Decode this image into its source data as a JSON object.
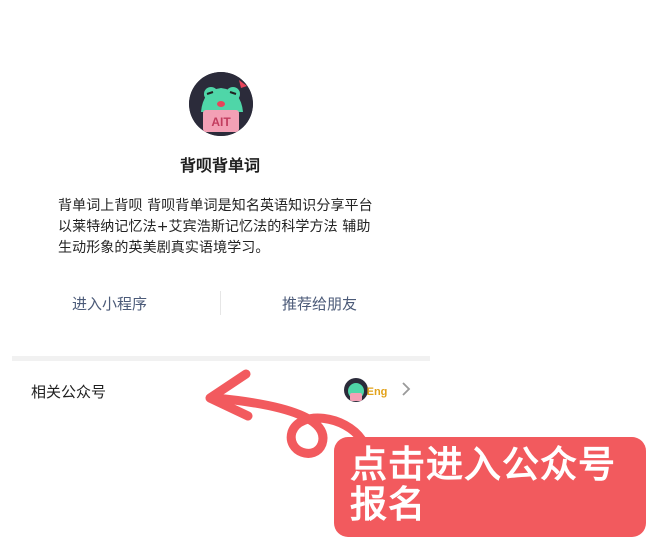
{
  "app": {
    "name": "背呗背单词",
    "description": "背单词上背呗 背呗背单词是知名英语知识分享平台 以莱特纳记忆法+艾宾浩斯记忆法的科学方法 辅助生动形象的英美剧真实语境学习。",
    "avatar_icon": "frog-mascot-icon"
  },
  "actions": {
    "enter_miniprogram": "进入小程序",
    "recommend_friends": "推荐给朋友"
  },
  "related": {
    "label": "相关公众号",
    "thumb_icon": "frog-eng-logo-icon",
    "chevron_icon": "chevron-right-icon"
  },
  "callout": {
    "text": "点击进入公众号报名",
    "color": "#f25a5e"
  }
}
